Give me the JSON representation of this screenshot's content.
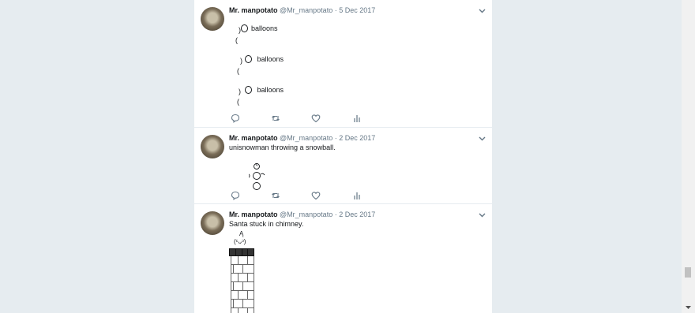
{
  "tweets": [
    {
      "name": "Mr. manpotato",
      "handle": "@Mr_manpotato",
      "separator": "·",
      "date": "5 Dec 2017",
      "lines": [
        "balloons",
        ")",
        "(",
        "balloons",
        ")",
        "(",
        "balloons",
        ")",
        "("
      ]
    },
    {
      "name": "Mr. manpotato",
      "handle": "@Mr_manpotato",
      "separator": "·",
      "date": "2 Dec 2017",
      "lines": [
        "unisnowman throwing a snowball.",
        "ͦ",
        "๐",
        "ᑕ"
      ]
    },
    {
      "name": "Mr. manpotato",
      "handle": "@Mr_manpotato",
      "separator": "·",
      "date": "2 Dec 2017",
      "lines": [
        "Santa stuck in chimney.",
        "Ą",
        "(ᶜᴗᵓ)"
      ]
    }
  ],
  "icons": [
    "reply-icon",
    "retweet-icon",
    "like-icon",
    "analytics-icon",
    "chevron-down-icon"
  ],
  "colors": {
    "background": "#e6ecf0",
    "card": "#ffffff",
    "muted": "#657786",
    "text": "#14171a"
  }
}
